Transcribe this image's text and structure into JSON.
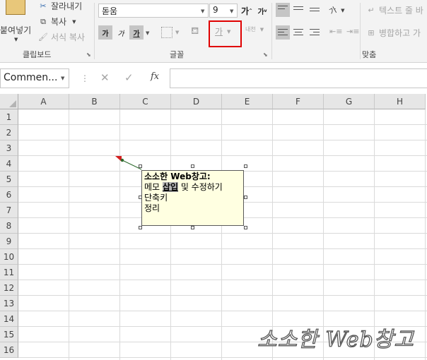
{
  "ribbon": {
    "clipboard": {
      "paste_label": "붙여넣기",
      "cut_label": "잘라내기",
      "copy_label": "복사",
      "format_painter_label": "서식 복사",
      "group_label": "클립보드"
    },
    "font": {
      "font_name": "돋움",
      "font_size": "9",
      "grow_label": "가",
      "shrink_label": "가",
      "bold_label": "가",
      "italic_label": "가",
      "underline_label": "가",
      "font_color_label": "가",
      "phonetic_label": "내천",
      "group_label": "글꼴"
    },
    "alignment": {
      "orientation_label": "가",
      "wrap_text_label": "텍스트 줄 바",
      "merge_label": "병합하고 가",
      "group_label": "맞춤"
    }
  },
  "formula_bar": {
    "name_box": "Commen...",
    "cancel_symbol": "✕",
    "enter_symbol": "✓",
    "fx_label": "fx"
  },
  "sheet": {
    "columns": [
      "A",
      "B",
      "C",
      "D",
      "E",
      "F",
      "G",
      "H"
    ],
    "rows": [
      "1",
      "2",
      "3",
      "4",
      "5",
      "6",
      "7",
      "8",
      "9",
      "10",
      "11",
      "12",
      "13",
      "14",
      "15",
      "16"
    ]
  },
  "comment": {
    "title": "소소한 Web창고:",
    "line2_before": "메모 ",
    "line2_selected": "삽입",
    "line2_after": " 및 수정하기",
    "line3": "단축키",
    "line4": "정리"
  },
  "watermark": "소소한 Web창고",
  "colors": {
    "highlight_box": "#e00000",
    "comment_bg": "#ffffe1",
    "ribbon_bg": "#f3f3f3"
  }
}
